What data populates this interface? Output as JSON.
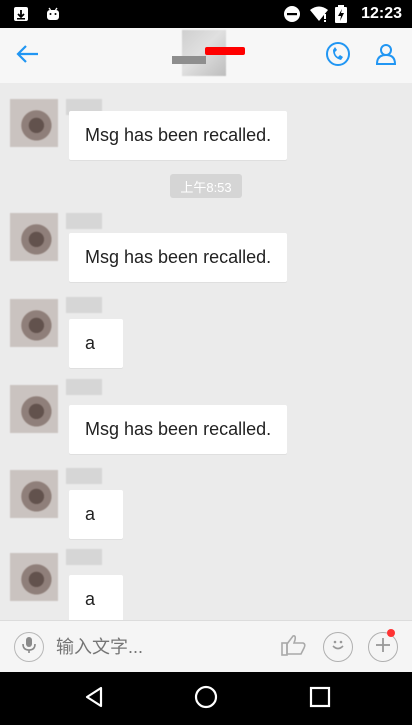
{
  "status_bar": {
    "time": "12:23",
    "icons": [
      "download-icon",
      "android-icon",
      "do-not-disturb-icon",
      "wifi-icon",
      "battery-charging-icon"
    ]
  },
  "header": {
    "back_icon": "arrow-left-icon",
    "call_icon": "phone-icon",
    "profile_icon": "person-icon"
  },
  "chat": {
    "timestamp": "上午8:53",
    "messages": [
      {
        "text": "Msg has been recalled."
      },
      {
        "text": "Msg has been recalled."
      },
      {
        "text": "a"
      },
      {
        "text": "Msg has been recalled."
      },
      {
        "text": "a"
      },
      {
        "text": "a"
      }
    ]
  },
  "input_bar": {
    "placeholder": "输入文字...",
    "mic_icon": "microphone-icon",
    "like_icon": "thumbs-up-icon",
    "emoji_icon": "smiley-icon",
    "plus_icon": "plus-icon"
  },
  "nav_bar": {
    "back_icon": "triangle-back-icon",
    "home_icon": "circle-home-icon",
    "recents_icon": "square-recents-icon"
  },
  "colors": {
    "accent": "#2196f3",
    "background": "#ebebeb",
    "bubble": "#ffffff",
    "redaction": "#ff0000"
  }
}
